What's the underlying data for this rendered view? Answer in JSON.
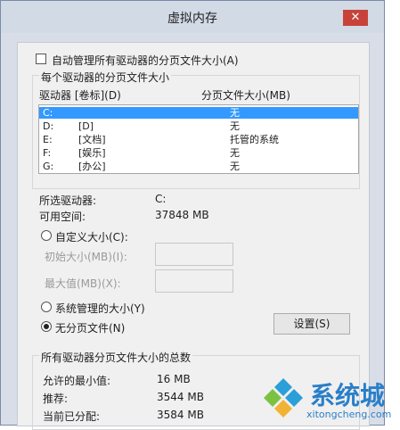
{
  "window": {
    "title": "虚拟内存",
    "close_label": "✕"
  },
  "auto_manage": {
    "label": "自动管理所有驱动器的分页文件大小(A)",
    "checked": false
  },
  "per_drive_group": {
    "title": "每个驱动器的分页文件大小",
    "col_drive": "驱动器 [卷标](D)",
    "col_pagefile": "分页文件大小(MB)",
    "rows": [
      {
        "drive": "C:",
        "label": "",
        "size": "无",
        "selected": true
      },
      {
        "drive": "D:",
        "label": "[D]",
        "size": "无",
        "selected": false
      },
      {
        "drive": "E:",
        "label": "[文档]",
        "size": "托管的系统",
        "selected": false
      },
      {
        "drive": "F:",
        "label": "[娱乐]",
        "size": "无",
        "selected": false
      },
      {
        "drive": "G:",
        "label": "[办公]",
        "size": "无",
        "selected": false
      }
    ]
  },
  "selected_drive": {
    "label": "所选驱动器:",
    "value": "C:",
    "space_label": "可用空间:",
    "space_value": "37848 MB"
  },
  "custom_size": {
    "label": "自定义大小(C):",
    "initial_label": "初始大小(MB)(I):",
    "max_label": "最大值(MB)(X):",
    "initial_value": "",
    "max_value": ""
  },
  "system_managed": {
    "label": "系统管理的大小(Y)"
  },
  "no_pagefile": {
    "label": "无分页文件(N)",
    "selected": true
  },
  "set_button": {
    "label": "设置(S)"
  },
  "total_group": {
    "title": "所有驱动器分页文件大小的总数",
    "min_label": "允许的最小值:",
    "min_value": "16 MB",
    "recommended_label": "推荐:",
    "recommended_value": "3544 MB",
    "current_label": "当前已分配:",
    "current_value": "3584 MB"
  },
  "watermark": {
    "brand": "系统城",
    "url": "xitongcheng.com"
  },
  "colors": {
    "selection": "#3399ff",
    "close": "#c7433a",
    "brand": "#2a7fc8"
  }
}
